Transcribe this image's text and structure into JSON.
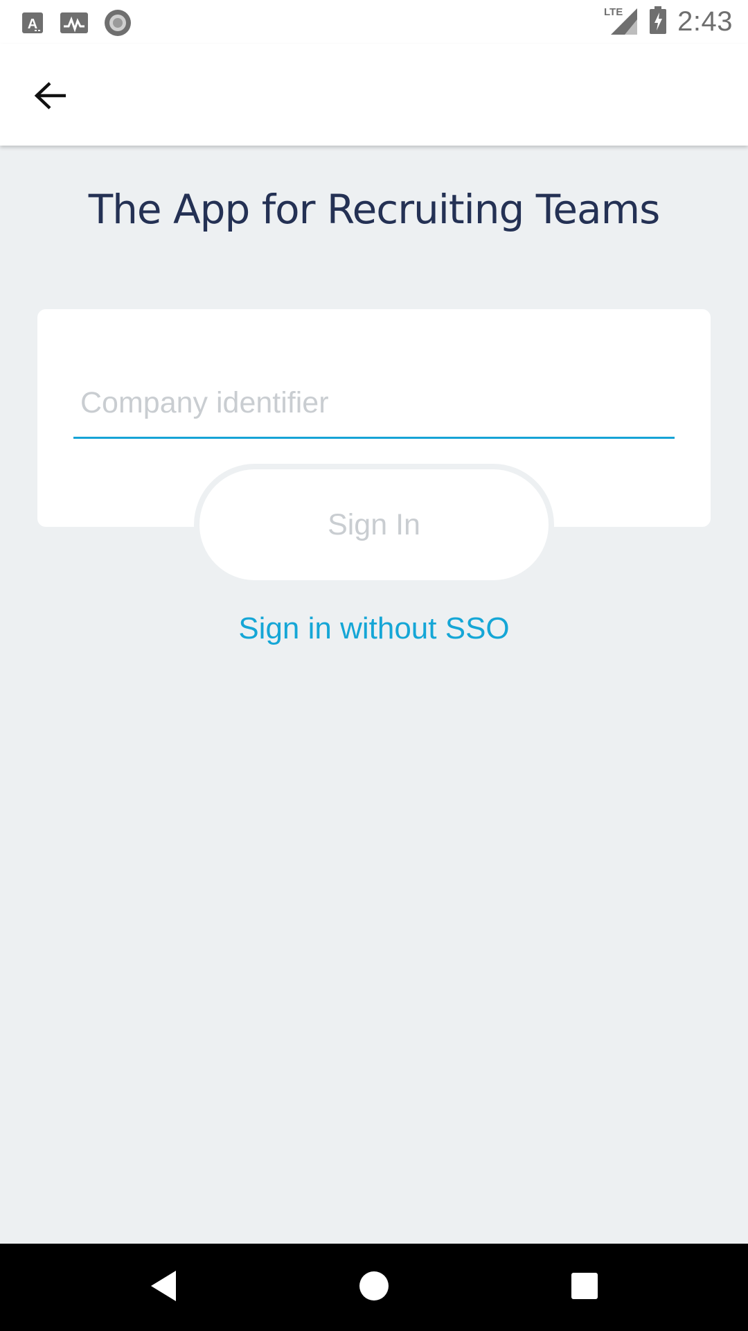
{
  "status_bar": {
    "time": "2:43",
    "network": "LTE",
    "icons": [
      "keyboard-a-icon",
      "activity-icon",
      "record-icon",
      "lte-signal-icon",
      "battery-charging-icon"
    ]
  },
  "app_bar": {
    "back_icon": "arrow-left-icon"
  },
  "page": {
    "title": "The App for Recruiting Teams"
  },
  "form": {
    "company_identifier": {
      "value": "",
      "placeholder": "Company identifier"
    },
    "sign_in_label": "Sign In",
    "sso_link_label": "Sign in without SSO"
  },
  "nav_bar": {
    "icons": [
      "nav-back-icon",
      "nav-home-icon",
      "nav-recents-icon"
    ]
  },
  "colors": {
    "background": "#edf0f2",
    "accent": "#15a6d6",
    "title": "#243154",
    "disabled_text": "#c9cdd1"
  }
}
